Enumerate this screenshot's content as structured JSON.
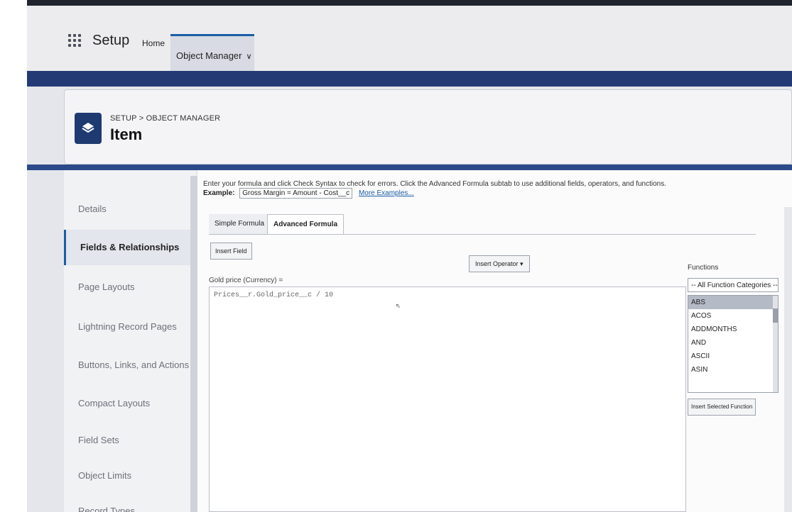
{
  "topnav": {
    "app_name": "Setup",
    "home_label": "Home",
    "object_manager_label": "Object Manager",
    "object_manager_chevron": "∨"
  },
  "header": {
    "breadcrumb": "SETUP > OBJECT MANAGER",
    "title": "Item",
    "icon": "layers-icon"
  },
  "sidebar": {
    "items": [
      {
        "label": "Details",
        "active": false
      },
      {
        "label": "Fields & Relationships",
        "active": true
      },
      {
        "label": "Page Layouts",
        "active": false
      },
      {
        "label": "Lightning Record Pages",
        "active": false
      },
      {
        "label": "Buttons, Links, and Actions",
        "active": false
      },
      {
        "label": "Compact Layouts",
        "active": false
      },
      {
        "label": "Field Sets",
        "active": false
      },
      {
        "label": "Object Limits",
        "active": false
      },
      {
        "label": "Record Types",
        "active": false
      }
    ]
  },
  "formula": {
    "instructions": "Enter your formula and click Check Syntax to check for errors. Click the Advanced Formula subtab to use additional fields, operators, and functions.",
    "example_label": "Example:",
    "example_value": "Gross Margin = Amount - Cost__c",
    "more_examples": "More Examples...",
    "tabs": [
      "Simple Formula",
      "Advanced Formula"
    ],
    "insert_field": "Insert Field",
    "insert_operator": "Insert Operator ▾",
    "field_label": "Gold price (Currency) =",
    "formula_text": "Prices__r.Gold_price__c  / 10"
  },
  "functions": {
    "label": "Functions",
    "category": "-- All Function Categories --",
    "items": [
      "ABS",
      "ACOS",
      "ADDMONTHS",
      "AND",
      "ASCII",
      "ASIN"
    ],
    "selected": "ABS",
    "insert_button": "Insert Selected Function"
  }
}
